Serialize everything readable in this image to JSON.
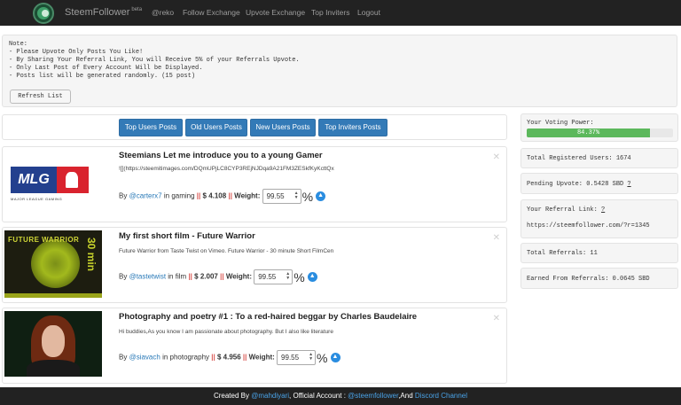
{
  "navbar": {
    "brand": "SteemFollower",
    "brand_sup": "beta",
    "links": [
      "@reko",
      "Follow Exchange",
      "Upvote Exchange",
      "Top Inviters",
      "Logout"
    ]
  },
  "note": {
    "lines": [
      "Note:",
      "- Please Upvote Only Posts You Like!",
      "- By Sharing Your Referral Link, You will Receive 5% of your Referrals Upvote.",
      "- Only Last Post of Every Account Will be Displayed.",
      "- Posts list will be generated randomly. (15 post)"
    ],
    "refresh_label": "Refresh List"
  },
  "tabs": [
    "Top Users Posts",
    "Old Users Posts",
    "New Users Posts",
    "Top Inviters Posts"
  ],
  "posts": [
    {
      "title": "Steemians Let me introduce you to a young Gamer",
      "body": "![](https://steemitimages.com/DQmUPjLC8CYP3REjNJDqa9A21FM3ZESkfKyKcttQx",
      "by": "By",
      "author": "@carterx7",
      "in": "in",
      "category": "gaming",
      "sep": "||",
      "amount": "$ 4.108",
      "weight_label": "Weight:",
      "weight_value": "99.55",
      "pct": "%",
      "thumb_text": "MLG",
      "thumb_sub": "MAJOR LEAGUE GAMING"
    },
    {
      "title": "My first short film - Future Warrior",
      "body": "Future Warrior from Taste Twist on Vimeo. Future Warrior - 30 minute Short FilmCen",
      "by": "By",
      "author": "@tastetwist",
      "in": "in",
      "category": "film",
      "sep": "||",
      "amount": "$ 2.007",
      "weight_label": "Weight:",
      "weight_value": "99.55",
      "pct": "%",
      "thumb_text": "FUTURE WARRIOR",
      "thumb_side": "30 min"
    },
    {
      "title": "Photography and poetry #1 : To a red-haired beggar by Charles Baudelaire",
      "body": "Hi buddies,As you know I am passionate about photography. But I also like literature",
      "by": "By",
      "author": "@siavach",
      "in": "in",
      "category": "photography",
      "sep": "||",
      "amount": "$ 4.956",
      "weight_label": "Weight:",
      "weight_value": "99.55",
      "pct": "%"
    }
  ],
  "sidebar": {
    "voting_power_label": "Your Voting Power:",
    "voting_power_value": "84.37%",
    "voting_power_fraction": 0.8437,
    "registered_users": "Total Registered Users: 1674",
    "pending_upvote": "Pending Upvote: 0.5428 SBD",
    "pending_help": "?",
    "referral_label": "Your Referral Link:",
    "referral_help": "?",
    "referral_link": "https://steemfollower.com/?r=1345",
    "total_referrals": "Total Referrals: 11",
    "earned": "Earned From Referrals: 0.0645 SBD"
  },
  "footer": {
    "created_by": "Created By",
    "creator": "@mahdiyari",
    "official": ", Official Account :",
    "official_account": "@steemfollower",
    "and": ",And",
    "discord": "Discord Channel"
  },
  "colors": {
    "navbar_bg": "#222222",
    "primary_button": "#337ab7",
    "link": "#2a7ab8",
    "progress": "#5cb85c",
    "separator": "#d9534f"
  },
  "icons": {
    "close": "close-icon",
    "upvote": "upvote-arrow-icon",
    "logo": "steemfollower-logo-icon"
  }
}
